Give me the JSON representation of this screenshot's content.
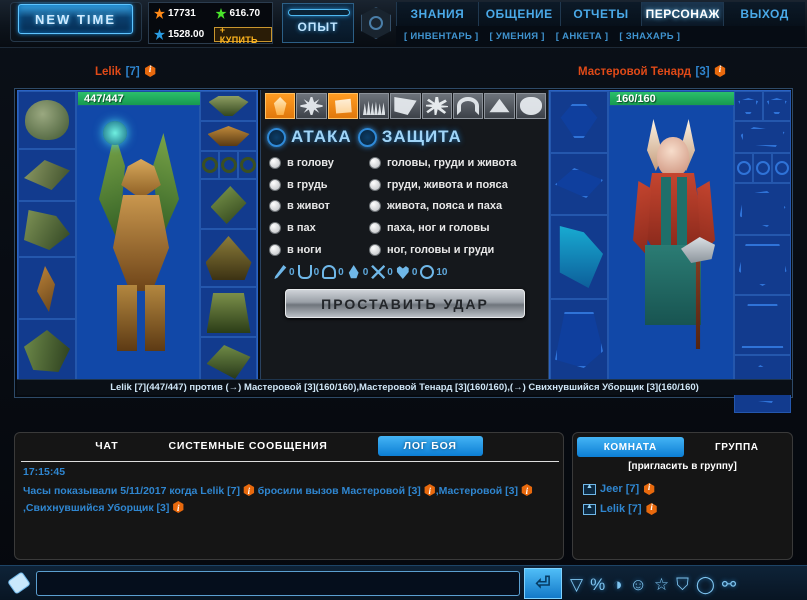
{
  "topbar": {
    "logo": "NEW TIME",
    "currency": {
      "gold": "17731",
      "green": "616.70",
      "blue": "1528.00",
      "buy_label": "+ КУПИТЬ"
    },
    "exp_label": "ОПЫТ",
    "nav": [
      {
        "label": "ЗНАНИЯ",
        "active": false
      },
      {
        "label": "ОБЩЕНИЕ",
        "active": false
      },
      {
        "label": "ОТЧЕТЫ",
        "active": false
      },
      {
        "label": "ПЕРСОНАЖ",
        "active": true
      },
      {
        "label": "ВЫХОД",
        "active": false
      }
    ],
    "subnav": [
      "[ ИНВЕНТАРЬ ]",
      "[ УМЕНИЯ ]",
      "[ АНКЕТА ]",
      "[ ЗНАХАРЬ ]"
    ]
  },
  "players": {
    "left": {
      "name": "Lelik",
      "level": "[7]",
      "hp": "447/447"
    },
    "right": {
      "name": "Мастеровой Тенард",
      "level": "[3]",
      "hp": "160/160"
    }
  },
  "combat": {
    "abilities": [
      {
        "name": "ability-flame",
        "active": true
      },
      {
        "name": "ability-sun",
        "active": false
      },
      {
        "name": "ability-scroll",
        "active": true
      },
      {
        "name": "ability-spikes",
        "active": false
      },
      {
        "name": "ability-wing",
        "active": false
      },
      {
        "name": "ability-star",
        "active": false
      },
      {
        "name": "ability-horseshoe",
        "active": false
      },
      {
        "name": "ability-triangle",
        "active": false
      },
      {
        "name": "ability-shell",
        "active": false
      }
    ],
    "mode_attack": "АТАКА",
    "mode_defence": "ЗАЩИТА",
    "attack_options": [
      "в голову",
      "в грудь",
      "в живот",
      "в пах",
      "в ноги"
    ],
    "defence_options": [
      "головы, груди и живота",
      "груди, живота и пояса",
      "живота, пояса и паха",
      "паха, ног и головы",
      "ног, головы и груди"
    ],
    "stats": [
      {
        "icon": "sword-icon",
        "value": "0"
      },
      {
        "icon": "shield-icon",
        "value": "0"
      },
      {
        "icon": "helmet-icon",
        "value": "0"
      },
      {
        "icon": "drop-icon",
        "value": "0"
      },
      {
        "icon": "crossed-swords-icon",
        "value": "0"
      },
      {
        "icon": "heart-icon",
        "value": "0"
      },
      {
        "icon": "circle-icon",
        "value": "10"
      }
    ],
    "hit_button": "ПРОСТАВИТЬ УДАР",
    "fight_line": "Lelik [7](447/447) против (→) Мастеровой [3](160/160),Мастеровой Тенард [3](160/160),(→) Свихнувшийся Уборщик [3](160/160)"
  },
  "chat": {
    "tabs": [
      {
        "label": "ЧАТ",
        "selected": false
      },
      {
        "label": "СИСТЕМНЫЕ СООБЩЕНИЯ",
        "selected": false
      },
      {
        "label": "ЛОГ БОЯ",
        "selected": true
      }
    ],
    "timestamp": "17:15:45",
    "log_part1": "Часы показывали 5/11/2017 когда ",
    "log_name1": "Lelik [7]",
    "log_part2": " бросили вызов ",
    "log_name2": "Мастеровой [3]",
    "log_part3": ",",
    "log_name3": "Мастеровой [3]",
    "log_part4": ",",
    "log_name4": "Свихнувшийся Уборщик [3]"
  },
  "room": {
    "tabs": [
      {
        "label": "КОМНАТА",
        "selected": true
      },
      {
        "label": "ГРУППА",
        "selected": false
      }
    ],
    "invite": "[пригласить в группу]",
    "members": [
      {
        "name": "Jeer [7]"
      },
      {
        "name": "Lelik [7]"
      }
    ]
  },
  "input": {
    "value": "",
    "placeholder": "",
    "send_icon": "⏎",
    "tools": [
      "▽",
      "%",
      "◑",
      "☺",
      "☆",
      "⛉",
      "◯",
      "⚯"
    ]
  },
  "colors": {
    "accent_blue": "#2f86d0",
    "orange": "#e06a14",
    "hp_green": "#2bbf6a",
    "panel_blue": "#0d2f7a"
  }
}
